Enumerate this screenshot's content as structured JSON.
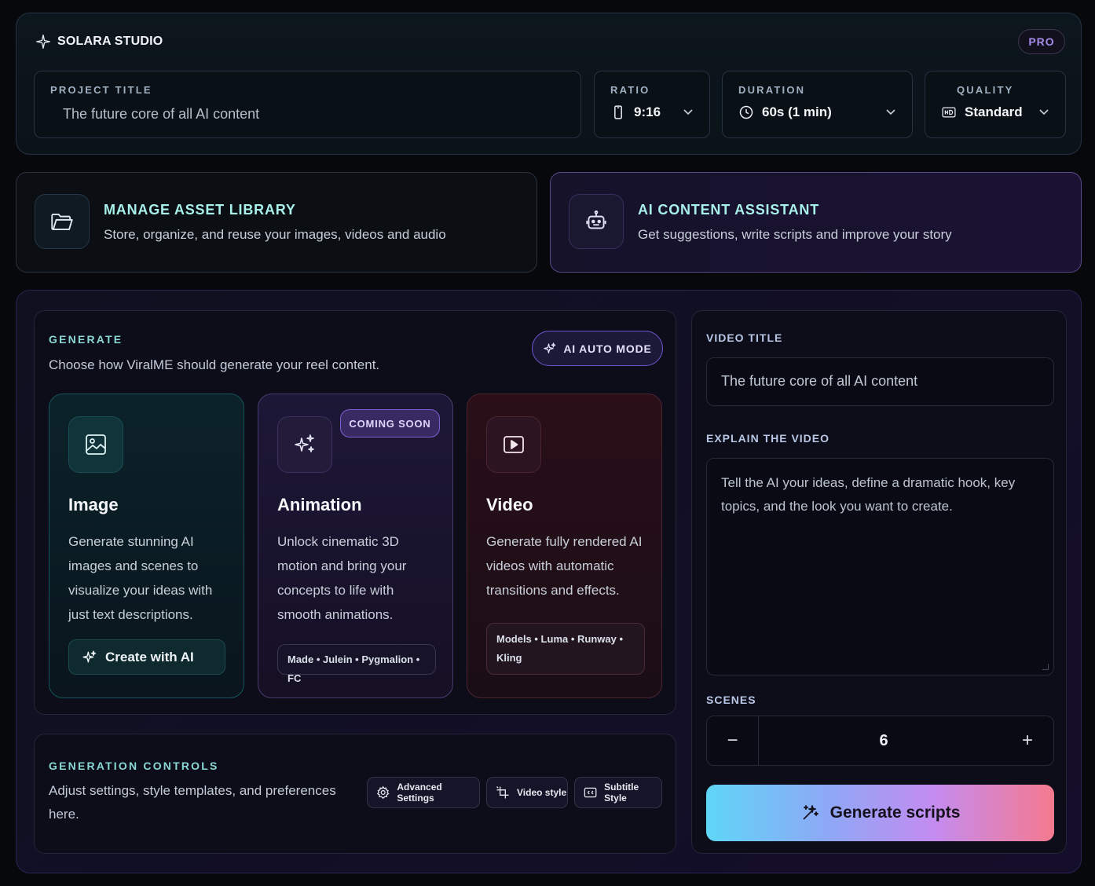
{
  "brand": {
    "name": "SOLARA STUDIO",
    "badge": "PRO"
  },
  "project": {
    "title_label": "PROJECT TITLE",
    "title_value": "The future core of all AI content",
    "ratio_label": "RATIO",
    "ratio_value": "9:16",
    "duration_label": "DURATION",
    "duration_value": "60s (1 min)",
    "quality_label": "QUALITY",
    "quality_value": "Standard"
  },
  "asset_library": {
    "title": "MANAGE ASSET LIBRARY",
    "desc": "Store, organize, and reuse your images, videos and audio"
  },
  "assistant": {
    "title": "AI CONTENT ASSISTANT",
    "desc": "Get suggestions, write scripts and improve your story"
  },
  "generate": {
    "label": "GENERATE",
    "desc": "Choose how ViralME should generate your reel content.",
    "auto_mode": "AI AUTO MODE",
    "cards": {
      "image": {
        "title": "Image",
        "desc": "Generate stunning AI images and scenes to visualize your ideas with just text descriptions.",
        "button": "Create with AI"
      },
      "animation": {
        "title": "Animation",
        "badge": "COMING SOON",
        "desc": "Unlock cinematic 3D motion and bring your concepts to life with smooth animations.",
        "models": "Made • Julein • Pygmalion • FC"
      },
      "video": {
        "title": "Video",
        "desc": "Generate fully rendered AI videos with automatic transitions and effects.",
        "models": "Models • Luma • Runway • Kling"
      }
    }
  },
  "controls": {
    "label": "GENERATION CONTROLS",
    "desc": "Adjust settings, style templates, and preferences here.",
    "advanced": "Advanced Settings",
    "video_style": "Video style",
    "subtitle_style": "Subtitle Style"
  },
  "video_form": {
    "title_label": "VIDEO TITLE",
    "title_value": "The future core of all AI content",
    "explain_label": "EXPLAIN THE VIDEO",
    "explain_placeholder": "Tell the AI your ideas, define a dramatic hook, key topics, and the look you want to create.",
    "scenes_label": "SCENES",
    "scenes_minus": "−",
    "scenes_value": "6",
    "scenes_plus": "+",
    "generate_button": "Generate scripts"
  },
  "colors": {
    "background": "#07080c",
    "accent_teal": "#a8f0ea",
    "accent_purple": "#a58be8",
    "generate_gradient_start": "#5fd6f7",
    "generate_gradient_end": "#f57a8f"
  },
  "icons": {
    "brand": "sparkle-icon",
    "ratio": "phone-icon",
    "duration": "clock-icon",
    "quality": "hd-icon",
    "asset": "folder-open-icon",
    "assistant": "robot-icon",
    "image": "image-icon",
    "animation": "sparkles-icon",
    "video": "play-icon"
  }
}
